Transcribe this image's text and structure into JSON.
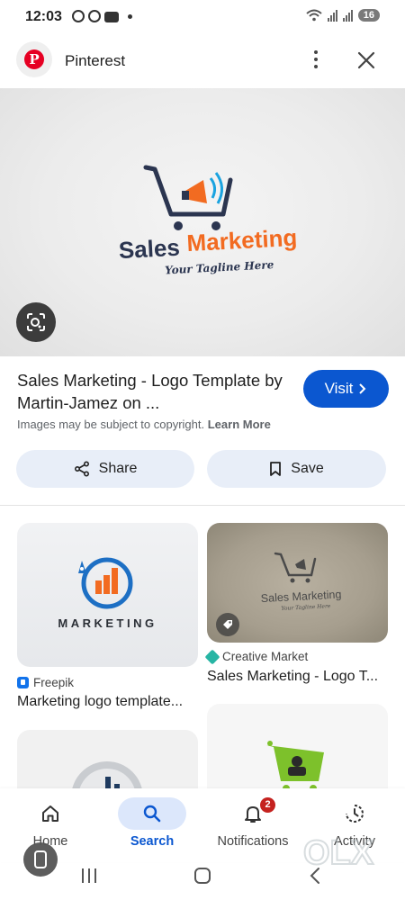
{
  "status_bar": {
    "time": "12:03",
    "battery": "16"
  },
  "header": {
    "site_name": "Pinterest",
    "logo_letter": "P"
  },
  "hero": {
    "brand_text_1": "Sales",
    "brand_text_2": "Marketing",
    "tagline": "Your Tagline Here"
  },
  "result": {
    "title": "Sales Marketing - Logo Template by Martin-Jamez on ...",
    "visit_label": "Visit",
    "copyright_text": "Images may be subject to copyright.",
    "learn_more": "Learn More"
  },
  "actions": {
    "share_label": "Share",
    "save_label": "Save"
  },
  "related": [
    {
      "image_text": "MARKETING",
      "source": "Freepik",
      "title": "Marketing logo template..."
    },
    {
      "image_text": "Sales Marketing",
      "image_tagline": "Your Tagline Here",
      "source": "Creative Market",
      "title": "Sales Marketing - Logo T..."
    }
  ],
  "bottom_nav": {
    "items": [
      {
        "label": "Home"
      },
      {
        "label": "Search"
      },
      {
        "label": "Notifications",
        "badge": "2"
      },
      {
        "label": "Activity"
      }
    ]
  },
  "watermark": "OLX",
  "colors": {
    "accent_blue": "#0b57d0",
    "pill_bg": "#e8eef8",
    "pinterest_red": "#e60023",
    "brand_orange": "#f26b21",
    "brand_navy": "#2b3550",
    "badge_red": "#c5221f"
  }
}
